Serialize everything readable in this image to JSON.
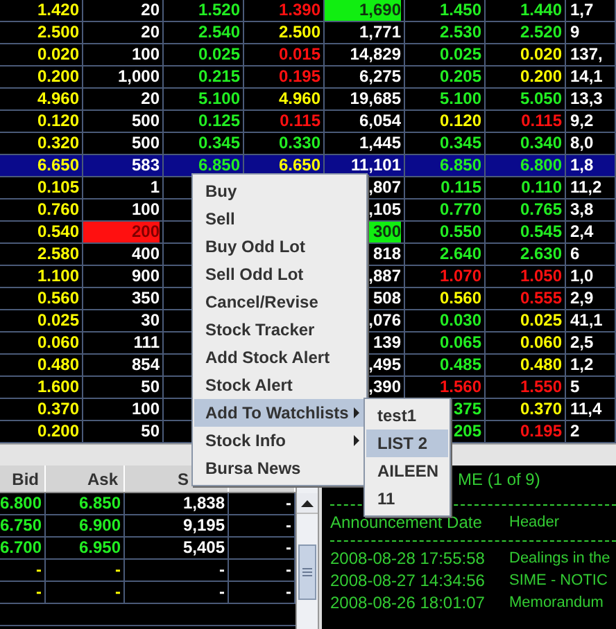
{
  "quote_table": {
    "rows": [
      {
        "selected": false,
        "cells": [
          {
            "text": "1.420",
            "kind": "same"
          },
          {
            "text": "20",
            "kind": "plain"
          },
          {
            "text": "1.520",
            "kind": "up"
          },
          {
            "text": "1.390",
            "kind": "down"
          },
          {
            "text": "1,690",
            "kind": "upflash"
          },
          {
            "text": "1.450",
            "kind": "up"
          },
          {
            "text": "1.440",
            "kind": "up"
          },
          {
            "text": "1,7",
            "kind": "plain"
          }
        ]
      },
      {
        "selected": false,
        "cells": [
          {
            "text": "2.500",
            "kind": "same"
          },
          {
            "text": "20",
            "kind": "plain"
          },
          {
            "text": "2.540",
            "kind": "up"
          },
          {
            "text": "2.500",
            "kind": "same"
          },
          {
            "text": "1,771",
            "kind": "plain"
          },
          {
            "text": "2.530",
            "kind": "up"
          },
          {
            "text": "2.520",
            "kind": "up"
          },
          {
            "text": "9",
            "kind": "plain"
          }
        ]
      },
      {
        "selected": false,
        "cells": [
          {
            "text": "0.020",
            "kind": "same"
          },
          {
            "text": "100",
            "kind": "plain"
          },
          {
            "text": "0.025",
            "kind": "up"
          },
          {
            "text": "0.015",
            "kind": "down"
          },
          {
            "text": "14,829",
            "kind": "plain"
          },
          {
            "text": "0.025",
            "kind": "up"
          },
          {
            "text": "0.020",
            "kind": "same"
          },
          {
            "text": "137,",
            "kind": "plain"
          }
        ]
      },
      {
        "selected": false,
        "cells": [
          {
            "text": "0.200",
            "kind": "same"
          },
          {
            "text": "1,000",
            "kind": "plain"
          },
          {
            "text": "0.215",
            "kind": "up"
          },
          {
            "text": "0.195",
            "kind": "down"
          },
          {
            "text": "6,275",
            "kind": "plain"
          },
          {
            "text": "0.205",
            "kind": "up"
          },
          {
            "text": "0.200",
            "kind": "same"
          },
          {
            "text": "14,1",
            "kind": "plain"
          }
        ]
      },
      {
        "selected": false,
        "cells": [
          {
            "text": "4.960",
            "kind": "same"
          },
          {
            "text": "20",
            "kind": "plain"
          },
          {
            "text": "5.100",
            "kind": "up"
          },
          {
            "text": "4.960",
            "kind": "same"
          },
          {
            "text": "19,685",
            "kind": "plain"
          },
          {
            "text": "5.100",
            "kind": "up"
          },
          {
            "text": "5.050",
            "kind": "up"
          },
          {
            "text": "13,3",
            "kind": "plain"
          }
        ]
      },
      {
        "selected": false,
        "cells": [
          {
            "text": "0.120",
            "kind": "same"
          },
          {
            "text": "500",
            "kind": "plain"
          },
          {
            "text": "0.125",
            "kind": "up"
          },
          {
            "text": "0.115",
            "kind": "down"
          },
          {
            "text": "6,054",
            "kind": "plain"
          },
          {
            "text": "0.120",
            "kind": "same"
          },
          {
            "text": "0.115",
            "kind": "down"
          },
          {
            "text": "9,2",
            "kind": "plain"
          }
        ]
      },
      {
        "selected": false,
        "cells": [
          {
            "text": "0.320",
            "kind": "same"
          },
          {
            "text": "500",
            "kind": "plain"
          },
          {
            "text": "0.345",
            "kind": "up"
          },
          {
            "text": "0.330",
            "kind": "up"
          },
          {
            "text": "1,445",
            "kind": "plain"
          },
          {
            "text": "0.345",
            "kind": "up"
          },
          {
            "text": "0.340",
            "kind": "up"
          },
          {
            "text": "8,0",
            "kind": "plain"
          }
        ]
      },
      {
        "selected": true,
        "cells": [
          {
            "text": "6.650",
            "kind": "same"
          },
          {
            "text": "583",
            "kind": "plain"
          },
          {
            "text": "6.850",
            "kind": "up"
          },
          {
            "text": "6.650",
            "kind": "same"
          },
          {
            "text": "11,101",
            "kind": "plain"
          },
          {
            "text": "6.850",
            "kind": "up"
          },
          {
            "text": "6.800",
            "kind": "up"
          },
          {
            "text": "1,8",
            "kind": "plain"
          }
        ]
      },
      {
        "selected": false,
        "cells": [
          {
            "text": "0.105",
            "kind": "same"
          },
          {
            "text": "1",
            "kind": "plain"
          },
          null,
          null,
          {
            "text": ",807",
            "kind": "plain"
          },
          {
            "text": "0.115",
            "kind": "up"
          },
          {
            "text": "0.110",
            "kind": "up"
          },
          {
            "text": "11,2",
            "kind": "plain"
          }
        ]
      },
      {
        "selected": false,
        "cells": [
          {
            "text": "0.760",
            "kind": "same"
          },
          {
            "text": "100",
            "kind": "plain"
          },
          null,
          null,
          {
            "text": ",105",
            "kind": "plain"
          },
          {
            "text": "0.770",
            "kind": "up"
          },
          {
            "text": "0.765",
            "kind": "up"
          },
          {
            "text": "3,8",
            "kind": "plain"
          }
        ]
      },
      {
        "selected": false,
        "cells": [
          {
            "text": "0.540",
            "kind": "same"
          },
          {
            "text": "200",
            "kind": "downflash"
          },
          null,
          null,
          {
            "text": "300",
            "kind": "upflash"
          },
          {
            "text": "0.550",
            "kind": "up"
          },
          {
            "text": "0.545",
            "kind": "up"
          },
          {
            "text": "2,4",
            "kind": "plain"
          }
        ]
      },
      {
        "selected": false,
        "cells": [
          {
            "text": "2.580",
            "kind": "same"
          },
          {
            "text": "400",
            "kind": "plain"
          },
          null,
          null,
          {
            "text": "818",
            "kind": "plain"
          },
          {
            "text": "2.640",
            "kind": "up"
          },
          {
            "text": "2.630",
            "kind": "up"
          },
          {
            "text": "6",
            "kind": "plain"
          }
        ]
      },
      {
        "selected": false,
        "cells": [
          {
            "text": "1.100",
            "kind": "same"
          },
          {
            "text": "900",
            "kind": "plain"
          },
          null,
          null,
          {
            "text": ",887",
            "kind": "plain"
          },
          {
            "text": "1.070",
            "kind": "down"
          },
          {
            "text": "1.050",
            "kind": "down"
          },
          {
            "text": "1,0",
            "kind": "plain"
          }
        ]
      },
      {
        "selected": false,
        "cells": [
          {
            "text": "0.560",
            "kind": "same"
          },
          {
            "text": "350",
            "kind": "plain"
          },
          null,
          null,
          {
            "text": "508",
            "kind": "plain"
          },
          {
            "text": "0.560",
            "kind": "same"
          },
          {
            "text": "0.555",
            "kind": "down"
          },
          {
            "text": "2,9",
            "kind": "plain"
          }
        ]
      },
      {
        "selected": false,
        "cells": [
          {
            "text": "0.025",
            "kind": "same"
          },
          {
            "text": "30",
            "kind": "plain"
          },
          null,
          null,
          {
            "text": ",076",
            "kind": "plain"
          },
          {
            "text": "0.030",
            "kind": "up"
          },
          {
            "text": "0.025",
            "kind": "same"
          },
          {
            "text": "41,1",
            "kind": "plain"
          }
        ]
      },
      {
        "selected": false,
        "cells": [
          {
            "text": "0.060",
            "kind": "same"
          },
          {
            "text": "111",
            "kind": "plain"
          },
          null,
          null,
          {
            "text": "139",
            "kind": "plain"
          },
          {
            "text": "0.065",
            "kind": "up"
          },
          {
            "text": "0.060",
            "kind": "same"
          },
          {
            "text": "2,5",
            "kind": "plain"
          }
        ]
      },
      {
        "selected": false,
        "cells": [
          {
            "text": "0.480",
            "kind": "same"
          },
          {
            "text": "854",
            "kind": "plain"
          },
          null,
          null,
          {
            "text": ",495",
            "kind": "plain"
          },
          {
            "text": "0.485",
            "kind": "up"
          },
          {
            "text": "0.480",
            "kind": "same"
          },
          {
            "text": "1,2",
            "kind": "plain"
          }
        ]
      },
      {
        "selected": false,
        "cells": [
          {
            "text": "1.600",
            "kind": "same"
          },
          {
            "text": "50",
            "kind": "plain"
          },
          null,
          null,
          {
            "text": ",390",
            "kind": "plain"
          },
          {
            "text": "1.560",
            "kind": "down"
          },
          {
            "text": "1.550",
            "kind": "down"
          },
          {
            "text": "5",
            "kind": "plain"
          }
        ]
      },
      {
        "selected": false,
        "cells": [
          {
            "text": "0.370",
            "kind": "same"
          },
          {
            "text": "100",
            "kind": "plain"
          },
          null,
          null,
          null,
          {
            "text": "375",
            "kind": "up"
          },
          {
            "text": "0.370",
            "kind": "same"
          },
          {
            "text": "11,4",
            "kind": "plain"
          }
        ]
      },
      {
        "selected": false,
        "cells": [
          {
            "text": "0.200",
            "kind": "same"
          },
          {
            "text": "50",
            "kind": "plain"
          },
          null,
          null,
          null,
          {
            "text": "205",
            "kind": "up"
          },
          {
            "text": "0.195",
            "kind": "down"
          },
          {
            "text": "2",
            "kind": "plain"
          }
        ]
      }
    ]
  },
  "depth_table": {
    "columns": [
      "Bid",
      "Ask",
      "S"
    ],
    "rows": [
      {
        "cells": [
          {
            "text": "6.800",
            "kind": "up"
          },
          {
            "text": "6.850",
            "kind": "up"
          },
          {
            "text": "1,838",
            "kind": "plain"
          },
          {
            "text": "-",
            "kind": "plain"
          }
        ]
      },
      {
        "cells": [
          {
            "text": "6.750",
            "kind": "up"
          },
          {
            "text": "6.900",
            "kind": "up"
          },
          {
            "text": "9,195",
            "kind": "plain"
          },
          {
            "text": "-",
            "kind": "plain"
          }
        ]
      },
      {
        "cells": [
          {
            "text": "6.700",
            "kind": "up"
          },
          {
            "text": "6.950",
            "kind": "up"
          },
          {
            "text": "5,405",
            "kind": "plain"
          },
          {
            "text": "-",
            "kind": "plain"
          }
        ]
      },
      {
        "cells": [
          {
            "text": "-",
            "kind": "same"
          },
          {
            "text": "-",
            "kind": "same"
          },
          {
            "text": "-",
            "kind": "plain"
          },
          {
            "text": "-",
            "kind": "plain"
          }
        ]
      },
      {
        "cells": [
          {
            "text": "-",
            "kind": "same"
          },
          {
            "text": "-",
            "kind": "same"
          },
          {
            "text": "-",
            "kind": "plain"
          },
          {
            "text": "-",
            "kind": "plain"
          }
        ]
      }
    ]
  },
  "announcements": {
    "title": "ME (1 of 9)",
    "columns": [
      "Announcement Date",
      "Header"
    ],
    "rows": [
      {
        "date": "2008-08-28 17:55:58",
        "header": "Dealings in the"
      },
      {
        "date": "2008-08-27 14:34:56",
        "header": "SIME - NOTIC"
      },
      {
        "date": "2008-08-26 18:01:07",
        "header": "Memorandum"
      }
    ]
  },
  "context_menu": {
    "items": [
      {
        "label": "Buy",
        "kind": "item",
        "selected": false
      },
      {
        "label": "Sell",
        "kind": "item",
        "selected": false
      },
      {
        "label": "Buy Odd Lot",
        "kind": "item",
        "selected": false
      },
      {
        "label": "Sell Odd Lot",
        "kind": "item",
        "selected": false
      },
      {
        "label": "Cancel/Revise",
        "kind": "item",
        "selected": false
      },
      {
        "label": "Stock Tracker",
        "kind": "item",
        "selected": false
      },
      {
        "label": "Add Stock Alert",
        "kind": "item",
        "selected": false
      },
      {
        "label": "Stock Alert",
        "kind": "item",
        "selected": false
      },
      {
        "label": "Add To Watchlists",
        "kind": "submenu",
        "selected": true
      },
      {
        "label": "Stock Info",
        "kind": "submenu",
        "selected": false
      },
      {
        "label": "Bursa News",
        "kind": "item",
        "selected": false
      }
    ]
  },
  "watchlist_submenu": {
    "items": [
      {
        "label": "test1",
        "selected": false
      },
      {
        "label": "LIST 2",
        "selected": true
      },
      {
        "label": "AILEEN",
        "selected": false
      },
      {
        "label": "11",
        "selected": false
      }
    ]
  }
}
